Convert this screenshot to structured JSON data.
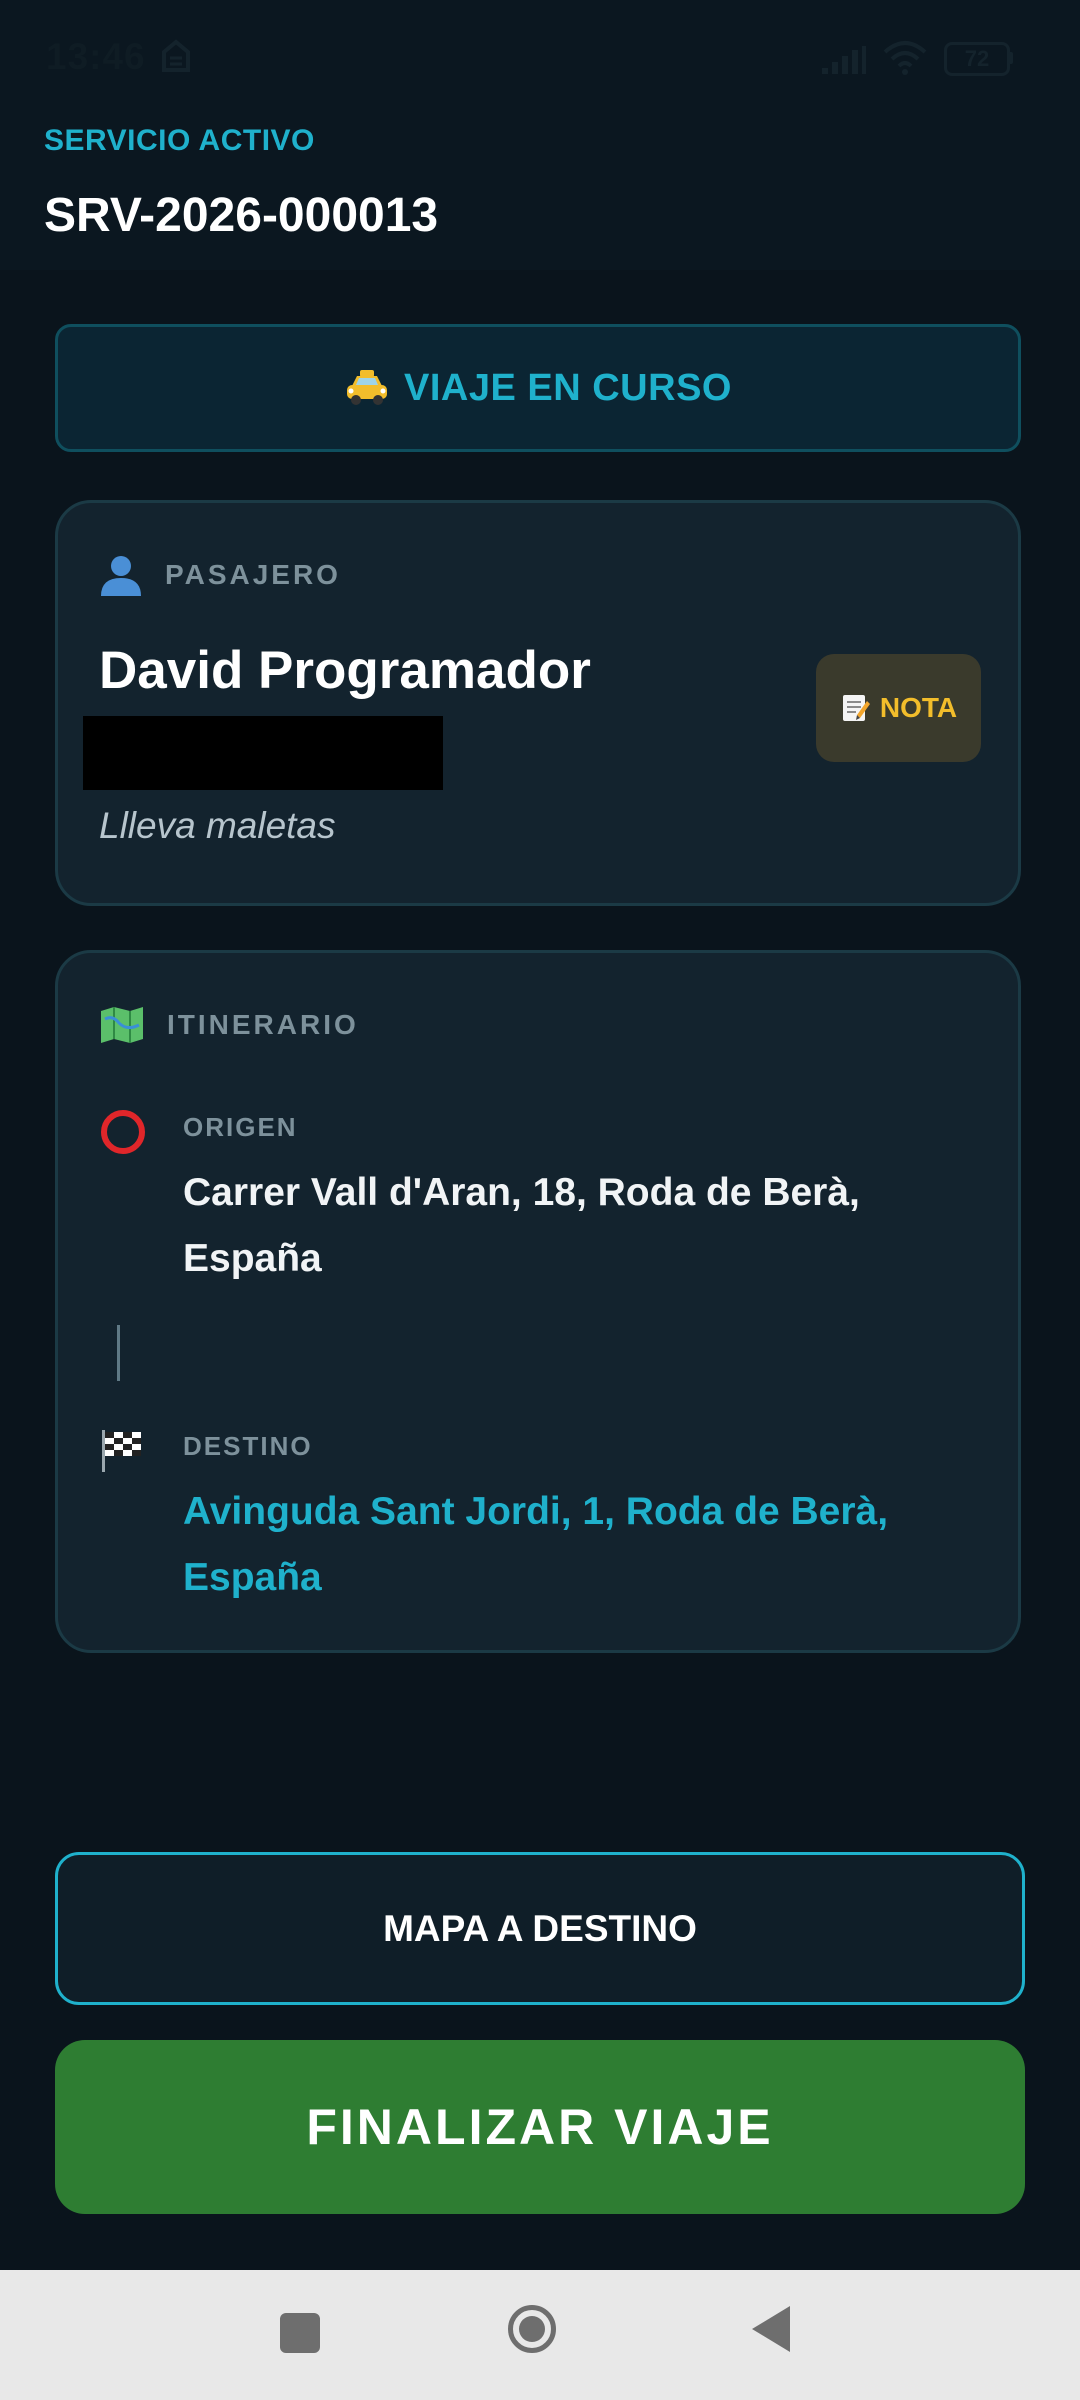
{
  "status_bar": {
    "time": "13:46",
    "battery": "72"
  },
  "header": {
    "label": "SERVICIO ACTIVO",
    "service_id": "SRV-2026-000013"
  },
  "trip_status": {
    "icon": "taxi-emoji",
    "text": "VIAJE EN CURSO"
  },
  "passenger": {
    "section_label": "PASAJERO",
    "name": "David Programador",
    "note": "Llleva maletas",
    "note_button": "NOTA"
  },
  "itinerary": {
    "section_label": "ITINERARIO",
    "origin_label": "ORIGEN",
    "origin_address": "Carrer Vall d'Aran, 18, Roda de Berà, España",
    "destination_label": "DESTINO",
    "destination_address": "Avinguda Sant Jordi, 1, Roda de Berà, España"
  },
  "actions": {
    "map_button": "MAPA A DESTINO",
    "finish_button": "FINALIZAR VIAJE"
  },
  "colors": {
    "accent": "#1fb1cc",
    "finish": "#2e7d32",
    "note": "#f2bd2b",
    "background": "#0a141c",
    "card": "#13232e"
  }
}
